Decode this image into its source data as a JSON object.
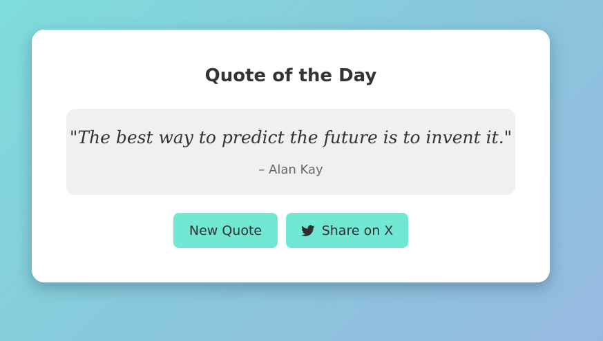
{
  "card": {
    "title": "Quote of the Day",
    "quote": {
      "text": "\"The best way to predict the future is to invent it.\"",
      "author": "– Alan Kay"
    },
    "buttons": {
      "new_quote_label": "New Quote",
      "share_label": "Share on X",
      "share_icon": "twitter-bird-icon"
    }
  },
  "colors": {
    "background_gradient_start": "#7fdcdc",
    "background_gradient_end": "#97b9e0",
    "button_accent": "#70e8d4",
    "quote_box": "#f0f0f0"
  }
}
